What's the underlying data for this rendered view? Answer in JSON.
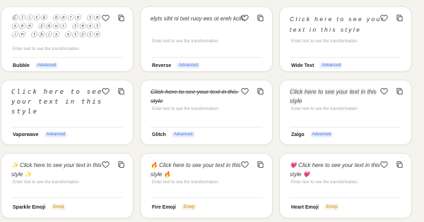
{
  "hint_text": "Enter text to see the transformation",
  "cards": [
    {
      "name": "Bubble",
      "badge": "Advanced",
      "preview": "Ⓒⓛⓘⓒⓚ ⓗⓔⓡⓔ ⓣⓞ ⓢⓔⓔ ⓨⓞⓤⓡ ⓣⓔⓧⓣ ⓘⓝ ⓣⓗⓘⓢ ⓢⓣⓨⓛⓔ"
    },
    {
      "name": "Reverse",
      "badge": "Advanced",
      "preview": "elyts siht ni txet ruoy ees ot ereh kcilC"
    },
    {
      "name": "Wide Text",
      "badge": "Advanced",
      "preview": "Click here to see your text in this style"
    },
    {
      "name": "Vaporwave",
      "badge": "Advanced",
      "preview": "Click here to see your text in this style"
    },
    {
      "name": "Glitch",
      "badge": "Advanced",
      "preview": "Click here to see your text in this style"
    },
    {
      "name": "Zalgo",
      "badge": "Advanced",
      "preview": "Click here to see your text in this style"
    },
    {
      "name": "Sparkle Emoji",
      "badge": "Emoji",
      "preview": "✨ Click here to see your text in this style ✨"
    },
    {
      "name": "Fire Emoji",
      "badge": "Emoji",
      "preview": "🔥 Click here to see your text in this style 🔥"
    },
    {
      "name": "Heart Emoji",
      "badge": "Emoji",
      "preview": "💗 Click here to see your text in this style 💗"
    }
  ],
  "colors": {
    "advanced_badge_text": "#3b6fd9",
    "advanced_badge_bg": "#e8effd",
    "emoji_badge_text": "#b88718",
    "emoji_badge_bg": "#fcf2dc",
    "page_bg": "#f4f3ee"
  },
  "icons": [
    "heart-icon",
    "copy-icon"
  ]
}
